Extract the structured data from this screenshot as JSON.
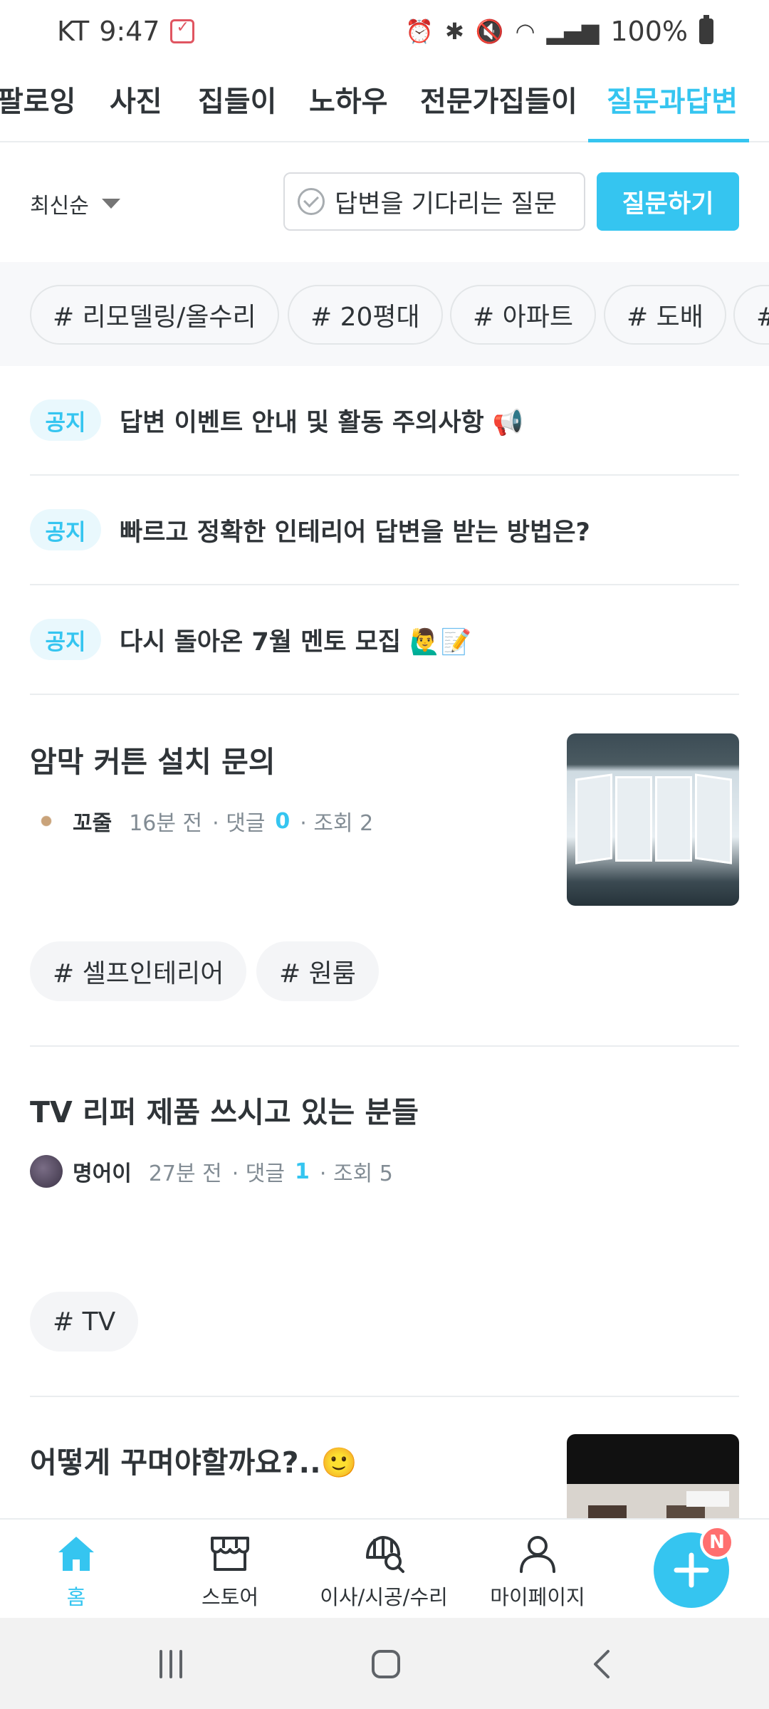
{
  "status": {
    "carrier": "KT",
    "time": "9:47",
    "battery": "100%"
  },
  "tabs": [
    "팔로잉",
    "사진",
    "집들이",
    "노하우",
    "전문가집들이",
    "질문과답변"
  ],
  "active_tab": "질문과답변",
  "filter": {
    "sort_label": "최신순",
    "waiting_label": "답변을 기다리는 질문",
    "ask_button": "질문하기"
  },
  "hashtags": [
    "# 리모델링/올수리",
    "# 20평대",
    "# 아파트",
    "# 도배",
    "# 다"
  ],
  "notices": [
    {
      "badge": "공지",
      "title": "답변 이벤트 안내 및 활동 주의사항 📢"
    },
    {
      "badge": "공지",
      "title": "빠르고 정확한 인테리어 답변을 받는 방법은?"
    },
    {
      "badge": "공지",
      "title": "다시 돌아온 7월 멘토 모집 🙋‍♂️📝"
    }
  ],
  "posts": [
    {
      "title": "암막 커튼 설치 문의",
      "author": "꼬줄",
      "time": "16분 전",
      "comments_label": "· 댓글",
      "comments": "0",
      "views": "· 조회 2",
      "tags": [
        "# 셀프인테리어",
        "# 원룸"
      ]
    },
    {
      "title": "TV 리퍼 제품 쓰시고 있는 분들",
      "author": "명어이",
      "time": "27분 전",
      "comments_label": "· 댓글",
      "comments": "1",
      "views": "· 조회 5",
      "tags": [
        "# TV"
      ]
    },
    {
      "title": "어떻게 꾸며야할까요?..🙂"
    }
  ],
  "bottom_nav": [
    {
      "label": "홈",
      "icon": "home-icon"
    },
    {
      "label": "스토어",
      "icon": "store-icon"
    },
    {
      "label": "이사/시공/수리",
      "icon": "service-icon"
    },
    {
      "label": "마이페이지",
      "icon": "user-icon"
    }
  ],
  "fab_badge": "N",
  "colors": {
    "accent": "#35c5f0",
    "text": "#2f3438",
    "muted": "#828c94",
    "badge": "#ff6f6f"
  }
}
